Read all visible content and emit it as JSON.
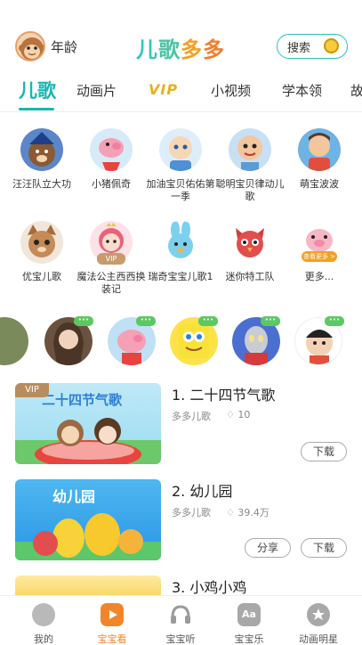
{
  "header": {
    "age_label": "年龄",
    "logo_text": [
      "儿",
      "歌",
      "多",
      "多"
    ],
    "search_label": "搜索"
  },
  "tabs": [
    "儿歌",
    "动画片",
    "VIP",
    "小视频",
    "学本领",
    "故"
  ],
  "grid": [
    {
      "label": "汪汪队立大功",
      "color": "#5b86c9"
    },
    {
      "label": "小猪佩奇",
      "color": "#f5a0b5"
    },
    {
      "label": "加油宝贝佑佑第一季",
      "color": "#a6d2f0"
    },
    {
      "label": "聪明宝贝律动儿歌",
      "color": "#c7e0f3"
    },
    {
      "label": "萌宝波波",
      "color": "#e85545"
    },
    {
      "label": "优宝儿歌",
      "color": "#c48a58"
    },
    {
      "label": "魔法公主西西换装记",
      "color": "#f39aa0",
      "badge": "VIP"
    },
    {
      "label": "瑞奇宝宝儿歌1",
      "color": "#7cd0ee"
    },
    {
      "label": "迷你特工队",
      "color": "#e24e4e"
    },
    {
      "label": "更多...",
      "color": "#f7b6c6",
      "badge": "查看更多 >"
    }
  ],
  "carousel": {
    "chat_glyph": "•••"
  },
  "list": [
    {
      "title": "1. 二十四节气歌",
      "source": "多多儿歌",
      "count": "10",
      "vip": "VIP",
      "thumb_text": "二十四节气歌",
      "buttons": [
        "下载"
      ]
    },
    {
      "title": "2. 幼儿园",
      "source": "多多儿歌",
      "count": "39.4万",
      "thumb_text": "幼儿园",
      "buttons": [
        "分享",
        "下载"
      ]
    },
    {
      "title": "3. 小鸡小鸡"
    }
  ],
  "bottom_nav": [
    {
      "label": "我的",
      "icon": "monkey-face-icon"
    },
    {
      "label": "宝宝看",
      "icon": "tv-icon",
      "active": true
    },
    {
      "label": "宝宝听",
      "icon": "headphones-icon"
    },
    {
      "label": "宝宝乐",
      "icon": "aa-learning-icon"
    },
    {
      "label": "动画明星",
      "icon": "star-bear-icon"
    }
  ],
  "colors": {
    "accent": "#18b6b0",
    "active_nav": "#f0862a",
    "vip": "#b88d5e"
  }
}
